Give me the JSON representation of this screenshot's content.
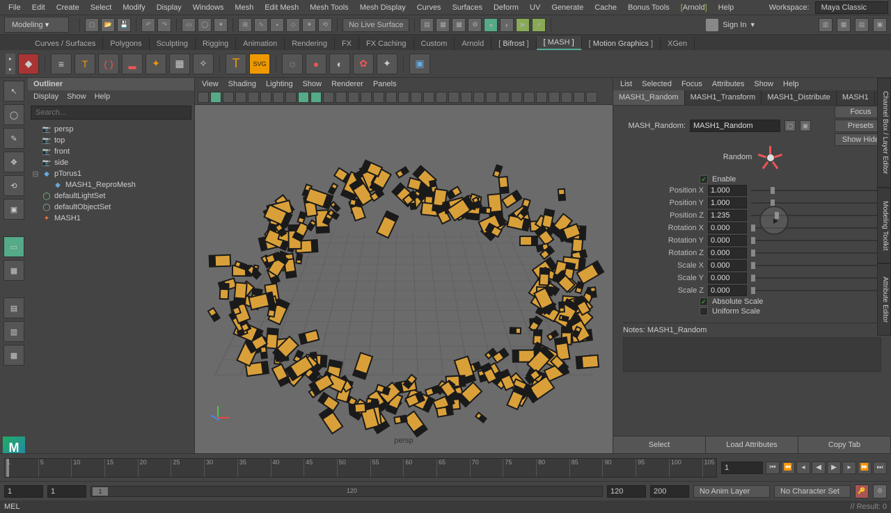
{
  "menubar": {
    "items": [
      "File",
      "Edit",
      "Create",
      "Select",
      "Modify",
      "Display",
      "Windows",
      "Mesh",
      "Edit Mesh",
      "Mesh Tools",
      "Mesh Display",
      "Curves",
      "Surfaces",
      "Deform",
      "UV",
      "Generate",
      "Cache",
      "Bonus Tools"
    ],
    "highlight": "Arnold",
    "last": "Help",
    "workspace_label": "Workspace:",
    "workspace_value": "Maya Classic"
  },
  "mode": "Modeling",
  "no_live_surface": "No Live Surface",
  "signin": "Sign In",
  "shelf_tabs": [
    "Curves / Surfaces",
    "Polygons",
    "Sculpting",
    "Rigging",
    "Animation",
    "Rendering",
    "FX",
    "FX Caching",
    "Custom",
    "Arnold",
    "Bifrost",
    "MASH",
    "Motion Graphics",
    "XGen"
  ],
  "active_shelf": "MASH",
  "outliner": {
    "title": "Outliner",
    "menus": [
      "Display",
      "Show",
      "Help"
    ],
    "search_ph": "Search...",
    "items": [
      {
        "icon": "cam",
        "label": "persp",
        "indent": 0
      },
      {
        "icon": "cam",
        "label": "top",
        "indent": 0
      },
      {
        "icon": "cam",
        "label": "front",
        "indent": 0
      },
      {
        "icon": "cam",
        "label": "side",
        "indent": 0
      },
      {
        "icon": "mesh",
        "label": "pTorus1",
        "indent": 0,
        "exp": "⊟"
      },
      {
        "icon": "mesh",
        "label": "MASH1_ReproMesh",
        "indent": 1
      },
      {
        "icon": "set",
        "label": "defaultLightSet",
        "indent": 0
      },
      {
        "icon": "set",
        "label": "defaultObjectSet",
        "indent": 0
      },
      {
        "icon": "mash",
        "label": "MASH1",
        "indent": 0
      }
    ]
  },
  "viewport": {
    "menus": [
      "View",
      "Shading",
      "Lighting",
      "Show",
      "Renderer",
      "Panels"
    ],
    "persp": "persp"
  },
  "attr": {
    "menus": [
      "List",
      "Selected",
      "Focus",
      "Attributes",
      "Show",
      "Help"
    ],
    "tabs": [
      "MASH1_Random",
      "MASH1_Transform",
      "MASH1_Distribute",
      "MASH1"
    ],
    "side": [
      "Focus",
      "Presets",
      "Show  Hide"
    ],
    "node_type": "MASH_Random:",
    "node_name": "MASH1_Random",
    "section": "Random",
    "enable": "Enable",
    "rows": [
      {
        "label": "Position X",
        "val": "1.000",
        "pos": 15
      },
      {
        "label": "Position Y",
        "val": "1.000",
        "pos": 15
      },
      {
        "label": "Position Z",
        "val": "1.235",
        "pos": 18
      },
      {
        "label": "Rotation X",
        "val": "0.000",
        "pos": 0
      },
      {
        "label": "Rotation Y",
        "val": "0.000",
        "pos": 0
      },
      {
        "label": "Rotation Z",
        "val": "0.000",
        "pos": 0
      },
      {
        "label": "Scale X",
        "val": "0.000",
        "pos": 0
      },
      {
        "label": "Scale Y",
        "val": "0.000",
        "pos": 0
      },
      {
        "label": "Scale Z",
        "val": "0.000",
        "pos": 0
      }
    ],
    "abs_scale": "Absolute Scale",
    "uni_scale": "Uniform Scale",
    "notes_label": "Notes:  MASH1_Random",
    "footer": [
      "Select",
      "Load Attributes",
      "Copy Tab"
    ]
  },
  "right_tabs": [
    "Channel Box / Layer Editor",
    "Modeling Toolkit",
    "Attribute Editor"
  ],
  "timeline": {
    "ticks": [
      1,
      5,
      10,
      15,
      20,
      25,
      30,
      35,
      40,
      45,
      50,
      55,
      60,
      65,
      70,
      75,
      80,
      85,
      90,
      95,
      100,
      105
    ],
    "current": "1"
  },
  "range": {
    "start_out": "1",
    "start_in": "1",
    "thumb": "1",
    "mid": "120",
    "end_in": "120",
    "end_out": "200",
    "anim_layer": "No Anim Layer",
    "char_set": "No Character Set"
  },
  "cmd": {
    "prompt": "MEL",
    "result": "// Result: 0"
  }
}
